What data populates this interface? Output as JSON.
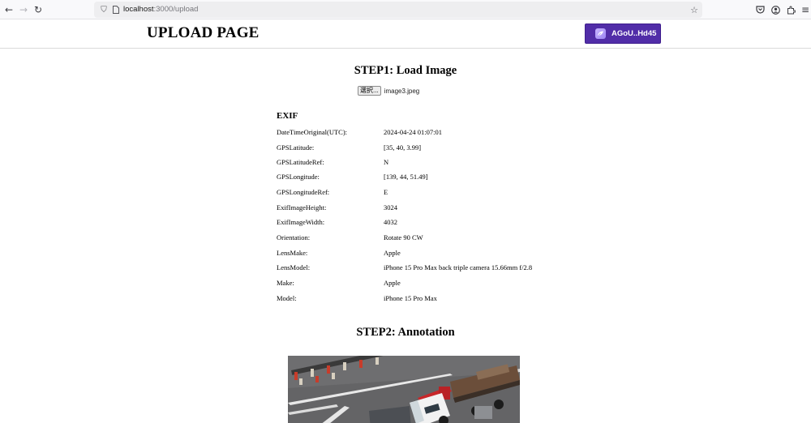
{
  "browser": {
    "url_host": "localhost",
    "url_path": ":3000/upload"
  },
  "header": {
    "title": "UPLOAD PAGE",
    "wallet_label": "AGoU..Hd45",
    "accent_color": "#512da8"
  },
  "step1": {
    "title": "STEP1: Load Image",
    "file_button": "選択...",
    "file_name": "image3.jpeg"
  },
  "exif": {
    "title": "EXIF",
    "rows": [
      {
        "key": "DateTimeOriginal(UTC):",
        "value": "2024-04-24 01:07:01"
      },
      {
        "key": "GPSLatitude:",
        "value": "[35, 40, 3.99]"
      },
      {
        "key": "GPSLatitudeRef:",
        "value": "N"
      },
      {
        "key": "GPSLongitude:",
        "value": "[139, 44, 51.49]"
      },
      {
        "key": "GPSLongitudeRef:",
        "value": "E"
      },
      {
        "key": "ExifImageHeight:",
        "value": "3024"
      },
      {
        "key": "ExifImageWidth:",
        "value": "4032"
      },
      {
        "key": "Orientation:",
        "value": "Rotate 90 CW"
      },
      {
        "key": "LensMake:",
        "value": "Apple"
      },
      {
        "key": "LensModel:",
        "value": "iPhone 15 Pro Max back triple camera 15.66mm f/2.8"
      },
      {
        "key": "Make:",
        "value": "Apple"
      },
      {
        "key": "Model:",
        "value": "iPhone 15 Pro Max"
      }
    ]
  },
  "step2": {
    "title": "STEP2: Annotation"
  }
}
